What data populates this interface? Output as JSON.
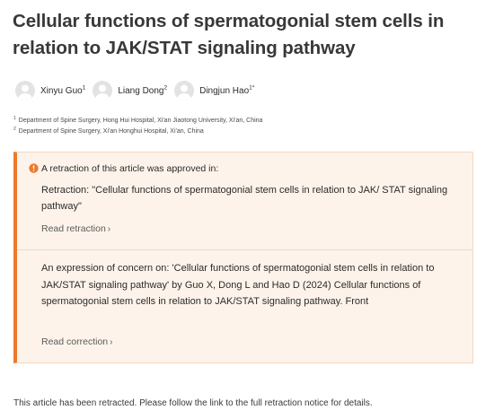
{
  "article": {
    "title": "Cellular functions of spermatogonial stem cells in relation to JAK/STAT signaling pathway"
  },
  "authors": [
    {
      "name": "Xinyu Guo",
      "sup": "1"
    },
    {
      "name": "Liang Dong",
      "sup": "2"
    },
    {
      "name": "Dingjun Hao",
      "sup": "1*"
    }
  ],
  "affiliations": [
    {
      "num": "1",
      "text": "Department of Spine Surgery, Hong Hui Hospital, Xi'an Jiaotong University, Xi'an, China"
    },
    {
      "num": "2",
      "text": "Department of Spine Surgery, Xi'an Honghui Hospital, Xi'an, China"
    }
  ],
  "notice": {
    "heading": "A retraction of this article was approved in:",
    "retraction_title": "Retraction: \"Cellular functions of spermatogonial stem cells in relation to JAK/ STAT signaling pathway\"",
    "retraction_link": "Read retraction",
    "concern_title": "An expression of concern on: 'Cellular functions of spermatogonial stem cells in relation to JAK/STAT signaling pathway' by Guo X, Dong L and Hao D (2024) Cellular functions of spermatogonial stem cells in relation to JAK/STAT signaling pathway. Front",
    "concern_link": "Read correction",
    "accent_color": "#ec7a2c",
    "background_color": "#fdf3ea",
    "icon": "exclamation-circle-icon"
  },
  "footer": {
    "text": "This article has been retracted. Please follow the link to the full retraction notice for details."
  },
  "icons": {
    "chevron": "›",
    "avatar": "user-avatar-icon"
  }
}
